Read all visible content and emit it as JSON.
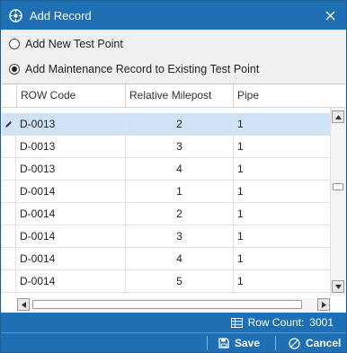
{
  "window": {
    "title": "Add Record"
  },
  "options": [
    {
      "label": "Add New Test Point",
      "checked": false
    },
    {
      "label": "Add Maintenance Record to Existing Test Point",
      "checked": true
    }
  ],
  "grid": {
    "columns": [
      "ROW Code",
      "Relative Milepost",
      "Pipe"
    ],
    "rows": [
      {
        "row_code": "D-0013",
        "milepost": "2",
        "pipe": "1",
        "selected": true,
        "editing": true
      },
      {
        "row_code": "D-0013",
        "milepost": "3",
        "pipe": "1"
      },
      {
        "row_code": "D-0013",
        "milepost": "4",
        "pipe": "1"
      },
      {
        "row_code": "D-0014",
        "milepost": "1",
        "pipe": "1"
      },
      {
        "row_code": "D-0014",
        "milepost": "2",
        "pipe": "1"
      },
      {
        "row_code": "D-0014",
        "milepost": "3",
        "pipe": "1"
      },
      {
        "row_code": "D-0014",
        "milepost": "4",
        "pipe": "1"
      },
      {
        "row_code": "D-0014",
        "milepost": "5",
        "pipe": "1"
      }
    ]
  },
  "status": {
    "row_count_label": "Row Count:",
    "row_count": "3001"
  },
  "footer": {
    "save_label": "Save",
    "cancel_label": "Cancel"
  },
  "colors": {
    "accent": "#1e6fb3",
    "selected_row": "#cfe3f7"
  },
  "icons": {
    "title": "app-logo-icon",
    "close": "close-icon",
    "grid": "grid-icon",
    "save": "save-icon",
    "cancel": "cancel-icon",
    "row_edit": "pencil-icon"
  }
}
